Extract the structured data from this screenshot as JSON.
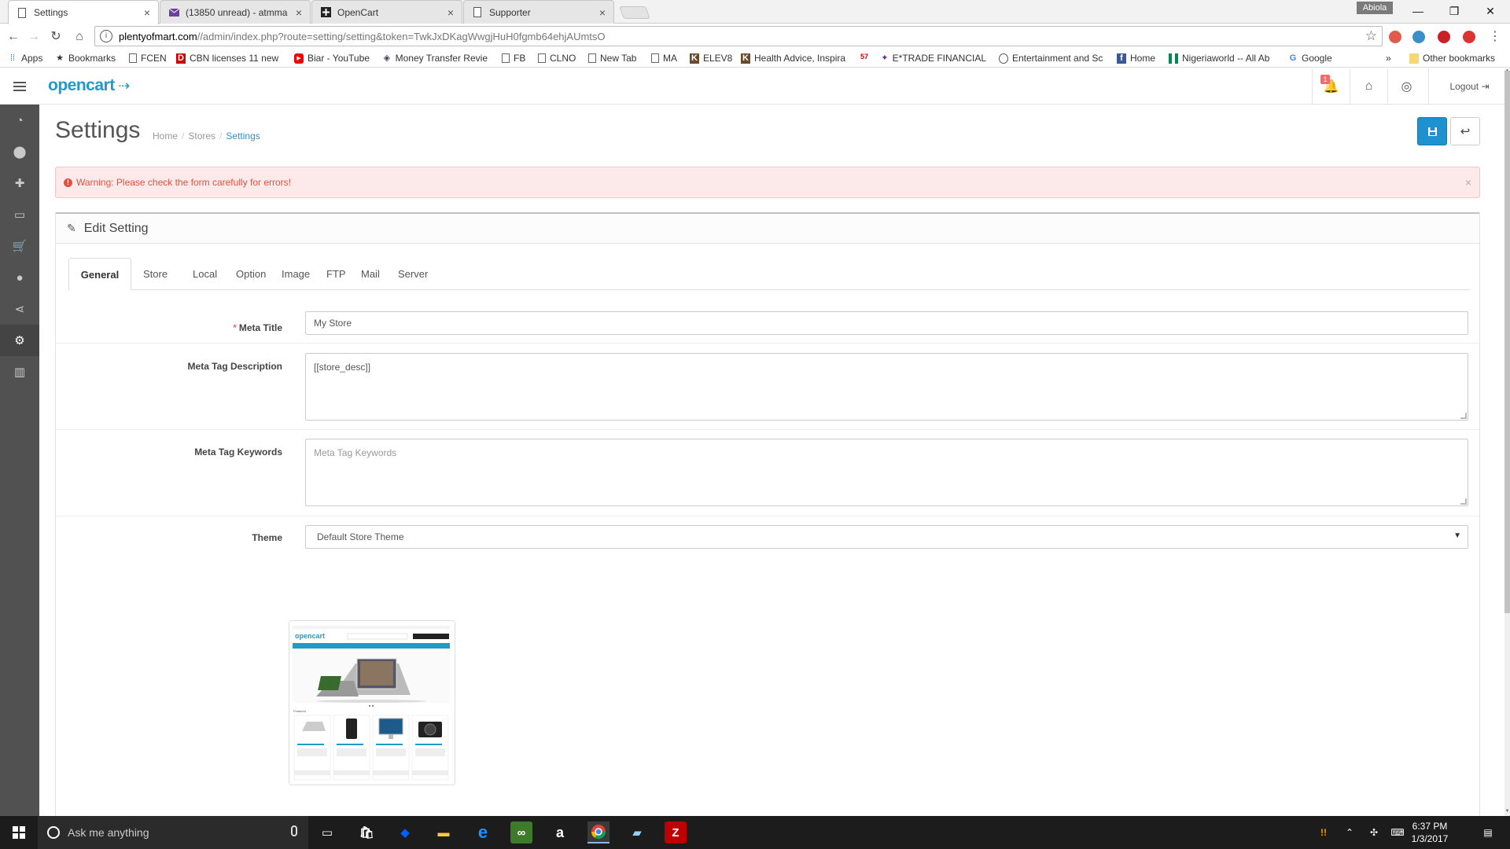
{
  "browser": {
    "tabs": [
      {
        "label": "Settings",
        "icon": "page-icon",
        "active": true
      },
      {
        "label": "(13850 unread) - atmma",
        "icon": "mail-icon",
        "active": false
      },
      {
        "label": "OpenCart",
        "icon": "opencart-icon",
        "active": false
      },
      {
        "label": "Supporter",
        "icon": "page-icon",
        "active": false
      }
    ],
    "profile_name": "Abiola",
    "url_host": "plentyofmart.com",
    "url_path": "//admin/index.php?route=setting/setting&token=TwkJxDKagWwgjHuH0fgmb64ehjAUmtsO",
    "bookmarks": [
      {
        "label": "Apps",
        "icon": "apps-icon"
      },
      {
        "label": "Bookmarks",
        "icon": "star-icon"
      },
      {
        "label": "FCEN",
        "icon": "page-icon"
      },
      {
        "label": "CBN licenses 11 new",
        "icon": "d-logo-icon"
      },
      {
        "label": "Biar - YouTube",
        "icon": "youtube-icon"
      },
      {
        "label": "Money Transfer Revie",
        "icon": "diamond-icon"
      },
      {
        "label": "FB",
        "icon": "page-icon"
      },
      {
        "label": "CLNO",
        "icon": "page-icon"
      },
      {
        "label": "New Tab",
        "icon": "page-icon"
      },
      {
        "label": "MA",
        "icon": "page-icon"
      },
      {
        "label": "ELEV8",
        "icon": "k-logo-icon"
      },
      {
        "label": "Health Advice, Inspira",
        "icon": "k-logo-icon"
      },
      {
        "label": "57",
        "icon": "number-icon"
      },
      {
        "label": "E*TRADE FINANCIAL",
        "icon": "etrade-icon"
      },
      {
        "label": "Entertainment and Sc",
        "icon": "circle-icon"
      },
      {
        "label": "Home",
        "icon": "facebook-icon"
      },
      {
        "label": "Nigeriaworld -- All Ab",
        "icon": "flag-icon"
      },
      {
        "label": "Google",
        "icon": "google-icon"
      }
    ],
    "overflow_label": "»",
    "other_bookmarks": "Other bookmarks"
  },
  "header": {
    "logo_text": "opencart",
    "notification_count": "1",
    "logout_label": "Logout"
  },
  "page": {
    "title": "Settings",
    "breadcrumb": [
      "Home",
      "Stores",
      "Settings"
    ],
    "alert": "Warning: Please check the form carefully for errors!",
    "panel_title": "Edit Setting",
    "tabs": [
      "General",
      "Store",
      "Local",
      "Option",
      "Image",
      "FTP",
      "Mail",
      "Server"
    ],
    "active_tab": "General"
  },
  "form": {
    "meta_title": {
      "label": "Meta Title",
      "value": "My Store",
      "required": true
    },
    "meta_description": {
      "label": "Meta Tag Description",
      "value": "[[store_desc]]"
    },
    "meta_keywords": {
      "label": "Meta Tag Keywords",
      "placeholder": "Meta Tag Keywords",
      "value": ""
    },
    "theme": {
      "label": "Theme",
      "value": "Default Store Theme"
    }
  },
  "taskbar": {
    "search_placeholder": "Ask me anything",
    "time": "6:37 PM",
    "date": "1/3/2017"
  },
  "colors": {
    "accent": "#229ac8",
    "save_button": "#1e91cf",
    "alert_text": "#e3503e",
    "alert_bg": "#fce9e9",
    "sidebar": "#515151",
    "required": "#f56b6b"
  }
}
